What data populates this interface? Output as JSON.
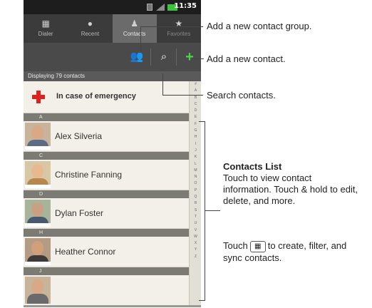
{
  "status_bar": {
    "time": "11:35"
  },
  "tabs": [
    {
      "label": "Dialer",
      "icon": "dialpad-icon"
    },
    {
      "label": "Recent",
      "icon": "clock-icon"
    },
    {
      "label": "Contacts",
      "icon": "person-icon",
      "active": true
    },
    {
      "label": "Favorites",
      "icon": "star-icon"
    }
  ],
  "action_bar": {
    "group_icon": "contact-group-icon",
    "search_icon": "search-icon",
    "add_icon": "add-contact-icon"
  },
  "count_label": "Displaying 79 contacts",
  "emergency": {
    "label": "In case of emergency"
  },
  "sections": [
    {
      "letter": "A",
      "contact": "Alex Silveria"
    },
    {
      "letter": "C",
      "contact": "Christine Fanning"
    },
    {
      "letter": "D",
      "contact": "Dylan Foster"
    },
    {
      "letter": "H",
      "contact": "Heather Connor"
    },
    {
      "letter": "J",
      "contact": ""
    }
  ],
  "index_letters": [
    "#",
    "A",
    "B",
    "C",
    "D",
    "E",
    "F",
    "G",
    "H",
    "I",
    "J",
    "K",
    "L",
    "M",
    "N",
    "O",
    "P",
    "Q",
    "R",
    "S",
    "T",
    "U",
    "V",
    "W",
    "X",
    "Y",
    "Z"
  ],
  "callouts": {
    "add_group": "Add a new contact group.",
    "add_contact": "Add a new contact.",
    "search": "Search contacts.",
    "list_title": "Contacts  List",
    "list_body": "Touch to view contact information. Touch & hold to edit, delete, and more.",
    "touch_prefix": "Touch",
    "touch_suffix": "to create, filter, and sync contacts."
  },
  "colors": {
    "add_green": "#4fd14f",
    "emergency_red": "#e0201f"
  }
}
